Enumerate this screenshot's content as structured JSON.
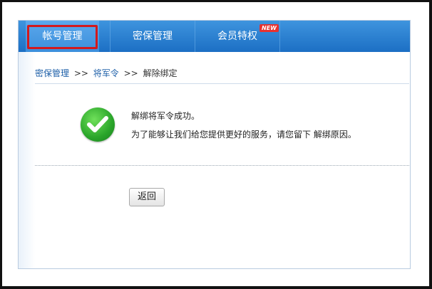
{
  "tabs": [
    {
      "label": "帐号管理",
      "active": true
    },
    {
      "label": "密保管理",
      "active": false
    },
    {
      "label": "会员特权",
      "active": false,
      "badge": "NEW"
    }
  ],
  "breadcrumb": {
    "items": [
      "密保管理",
      "将军令",
      "解除绑定"
    ],
    "separator": ">>"
  },
  "result": {
    "title": "解绑将军令成功。",
    "message": "为了能够让我们给您提供更好的服务，请您留下 解绑原因。"
  },
  "back_button": "返回",
  "colors": {
    "tabbar": "#1c6fc4",
    "highlight": "#d3191d",
    "success": "#2aa52a",
    "link": "#1d5fa8"
  },
  "icons": {
    "success": "check-circle-icon"
  }
}
